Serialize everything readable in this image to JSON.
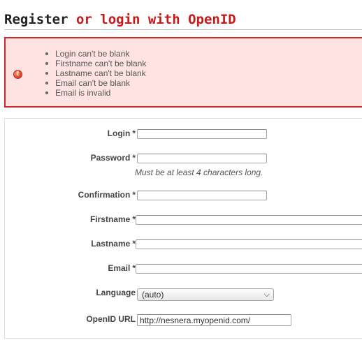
{
  "header": {
    "title": "Register",
    "alt_link": "or login with OpenID"
  },
  "errors": {
    "icon": "error-icon",
    "items": [
      "Login can't be blank",
      "Firstname can't be blank",
      "Lastname can't be blank",
      "Email can't be blank",
      "Email is invalid"
    ]
  },
  "form": {
    "required_marker": "*",
    "login": {
      "label": "Login",
      "value": ""
    },
    "password": {
      "label": "Password",
      "value": "",
      "hint": "Must be at least 4 characters long."
    },
    "confirmation": {
      "label": "Confirmation",
      "value": ""
    },
    "firstname": {
      "label": "Firstname",
      "value": ""
    },
    "lastname": {
      "label": "Lastname",
      "value": ""
    },
    "email": {
      "label": "Email",
      "value": ""
    },
    "language": {
      "label": "Language",
      "selected": "(auto)"
    },
    "openid": {
      "label": "OpenID URL",
      "value": "http://nesnera.myopenid.com/"
    }
  },
  "colors": {
    "error_border": "#cc2a2a",
    "error_bg": "#ffe3e3",
    "link_red": "#c61a1a"
  }
}
